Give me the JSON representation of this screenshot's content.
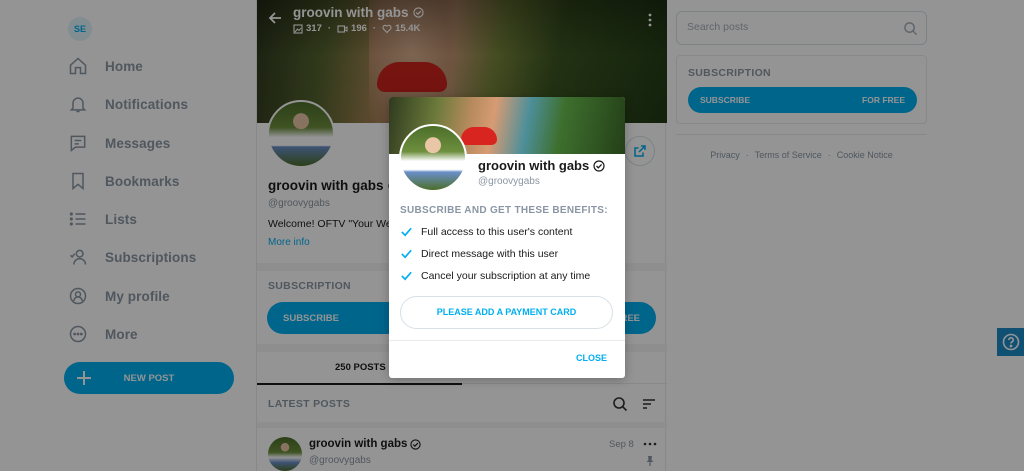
{
  "sidebar": {
    "user_initials": "SE",
    "items": [
      {
        "label": "Home"
      },
      {
        "label": "Notifications"
      },
      {
        "label": "Messages"
      },
      {
        "label": "Bookmarks"
      },
      {
        "label": "Lists"
      },
      {
        "label": "Subscriptions"
      },
      {
        "label": "My profile"
      },
      {
        "label": "More"
      }
    ],
    "new_post_label": "NEW POST"
  },
  "profile": {
    "name": "groovin with gabs",
    "handle": "@groovygabs",
    "stats": {
      "photos": "317",
      "videos": "196",
      "likes": "15.4K"
    },
    "bio": "Welcome! OFTV \"Your We",
    "more_info": "More info",
    "subscription_heading": "SUBSCRIPTION",
    "subscribe_label": "SUBSCRIBE",
    "subscribe_price": "FREE",
    "tabs": [
      {
        "label": "250 POSTS"
      }
    ],
    "latest_posts_heading": "LATEST POSTS"
  },
  "post": {
    "author": "groovin with gabs",
    "handle": "@groovygabs",
    "date": "Sep 8"
  },
  "right": {
    "search_placeholder": "Search posts",
    "subscription_heading": "SUBSCRIPTION",
    "subscribe_label": "SUBSCRIBE",
    "subscribe_price": "FOR FREE",
    "footer_links": [
      "Privacy",
      "Terms of Service",
      "Cookie Notice"
    ]
  },
  "modal": {
    "name": "groovin with gabs",
    "handle": "@groovygabs",
    "benefits_title": "SUBSCRIBE AND GET THESE BENEFITS:",
    "benefits": [
      "Full access to this user's content",
      "Direct message with this user",
      "Cancel your subscription at any time"
    ],
    "payment_button": "PLEASE ADD A PAYMENT CARD",
    "close_label": "CLOSE"
  },
  "colors": {
    "accent": "#00aff0",
    "muted": "#8a96a3",
    "help_button": "#1c8bc7"
  }
}
